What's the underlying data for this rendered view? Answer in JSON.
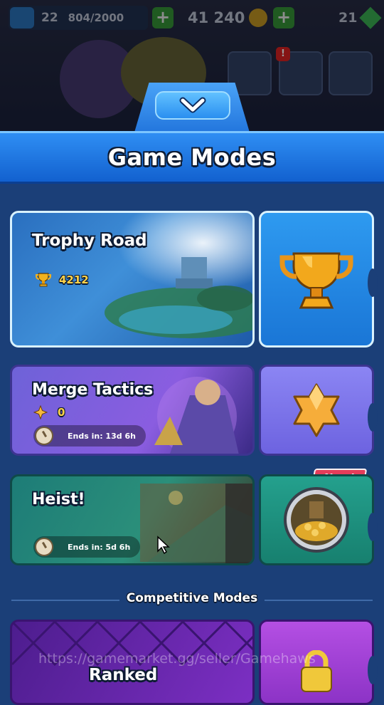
{
  "top_bar": {
    "level": "22",
    "xp_progress": "804/2000",
    "gold": "41 240",
    "gems": "21"
  },
  "screen": {
    "title": "Game Modes"
  },
  "modes": {
    "trophy_road": {
      "title": "Trophy Road",
      "trophies": "4212"
    },
    "merge_tactics": {
      "title": "Merge Tactics",
      "stars": "0",
      "timer": "Ends in: 13d 6h"
    },
    "heist": {
      "title": "Heist!",
      "timer": "Ends in: 5d 6h",
      "badge": "New!"
    },
    "ranked": {
      "title": "Ranked"
    }
  },
  "section": {
    "competitive_label": "Competitive Modes"
  },
  "watermark": "https://gamemarket.gg/seller/Gamehaws",
  "colors": {
    "header_blue": "#1f78e6",
    "trophy_gold": "#e8a51c",
    "new_badge": "#e43d5a",
    "merge_purple": "#7a6bf0",
    "heist_teal": "#1e8d80",
    "ranked_purple": "#8c33c6"
  }
}
